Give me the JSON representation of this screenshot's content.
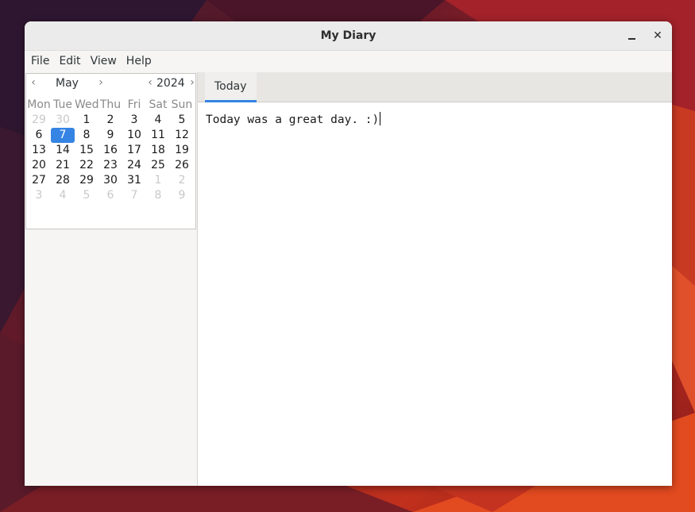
{
  "window": {
    "title": "My Diary"
  },
  "menubar": {
    "items": [
      "File",
      "Edit",
      "View",
      "Help"
    ]
  },
  "calendar": {
    "month": "May",
    "year": "2024",
    "weekdays": [
      "Mon",
      "Tue",
      "Wed",
      "Thu",
      "Fri",
      "Sat",
      "Sun"
    ],
    "weeks": [
      [
        "29",
        "30",
        "1",
        "2",
        "3",
        "4",
        "5"
      ],
      [
        "6",
        "7",
        "8",
        "9",
        "10",
        "11",
        "12"
      ],
      [
        "13",
        "14",
        "15",
        "16",
        "17",
        "18",
        "19"
      ],
      [
        "20",
        "21",
        "22",
        "23",
        "24",
        "25",
        "26"
      ],
      [
        "27",
        "28",
        "29",
        "30",
        "31",
        "1",
        "2"
      ],
      [
        "3",
        "4",
        "5",
        "6",
        "7",
        "8",
        "9"
      ]
    ],
    "selected_day": "7",
    "accent_color": "#3584e4"
  },
  "tabs": [
    {
      "label": "Today",
      "active": true
    }
  ],
  "editor": {
    "text": "Today was a great day. :)"
  }
}
